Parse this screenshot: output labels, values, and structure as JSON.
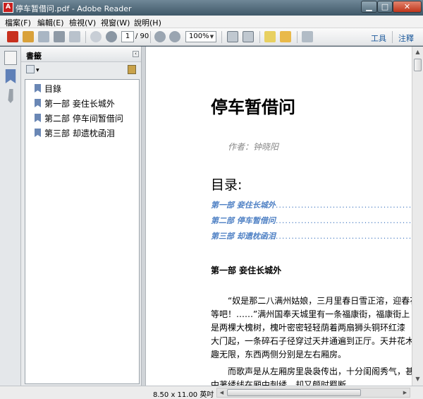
{
  "window": {
    "title": "停车暂借问.pdf - Adobe Reader",
    "app_icon": "adobe-reader-icon"
  },
  "menu": [
    "檔案(F)",
    "編輯(E)",
    "檢視(V)",
    "視窗(W)",
    "說明(H)"
  ],
  "toolbar": {
    "page_current": "1",
    "page_total": "/ 90",
    "zoom": "100%",
    "tools_label": "工具",
    "comment_label": "注釋"
  },
  "bookmarks": {
    "panel_title": "書籤",
    "items": [
      "目錄",
      "第一部 妾住长城外",
      "第二部 停车间暂借问",
      "第三部 却遗枕函泪"
    ]
  },
  "document": {
    "title": "停车暂借问",
    "author": "作者：钟晓阳",
    "toc_heading": "目录:",
    "toc": [
      "第一部  妾住长城外",
      "第二部  停车暂借问",
      "第三部    却遗枕函泪"
    ],
    "section_heading": "第一部  妾住长城外",
    "paragraphs": [
      "“奴是那二八满州姑娘，三月里春日雪正溶，迎春花",
      "等吧！……”满州国奉天城里有一条福康街，福康街上",
      "是两棵大槐树，槐叶密密轻轻荫着两扇狮头铜环红漆",
      "大门起，一条碎石子径穿过天井通遍到正厅。天井花木",
      "趣无限，东西两侧分别是左右厢房。",
      "　　而歌声是从左厢房里袅袅传出，十分闺阁秀气，甚",
      "中著绣线在厢中刺绣，却又颇时羁断"
    ]
  },
  "status": {
    "page_size": "8.50 x 11.00 英吋"
  },
  "colors": {
    "toc_link": "#4e80c4",
    "titlebar": "#4f6878",
    "close_button": "#c8452a"
  }
}
